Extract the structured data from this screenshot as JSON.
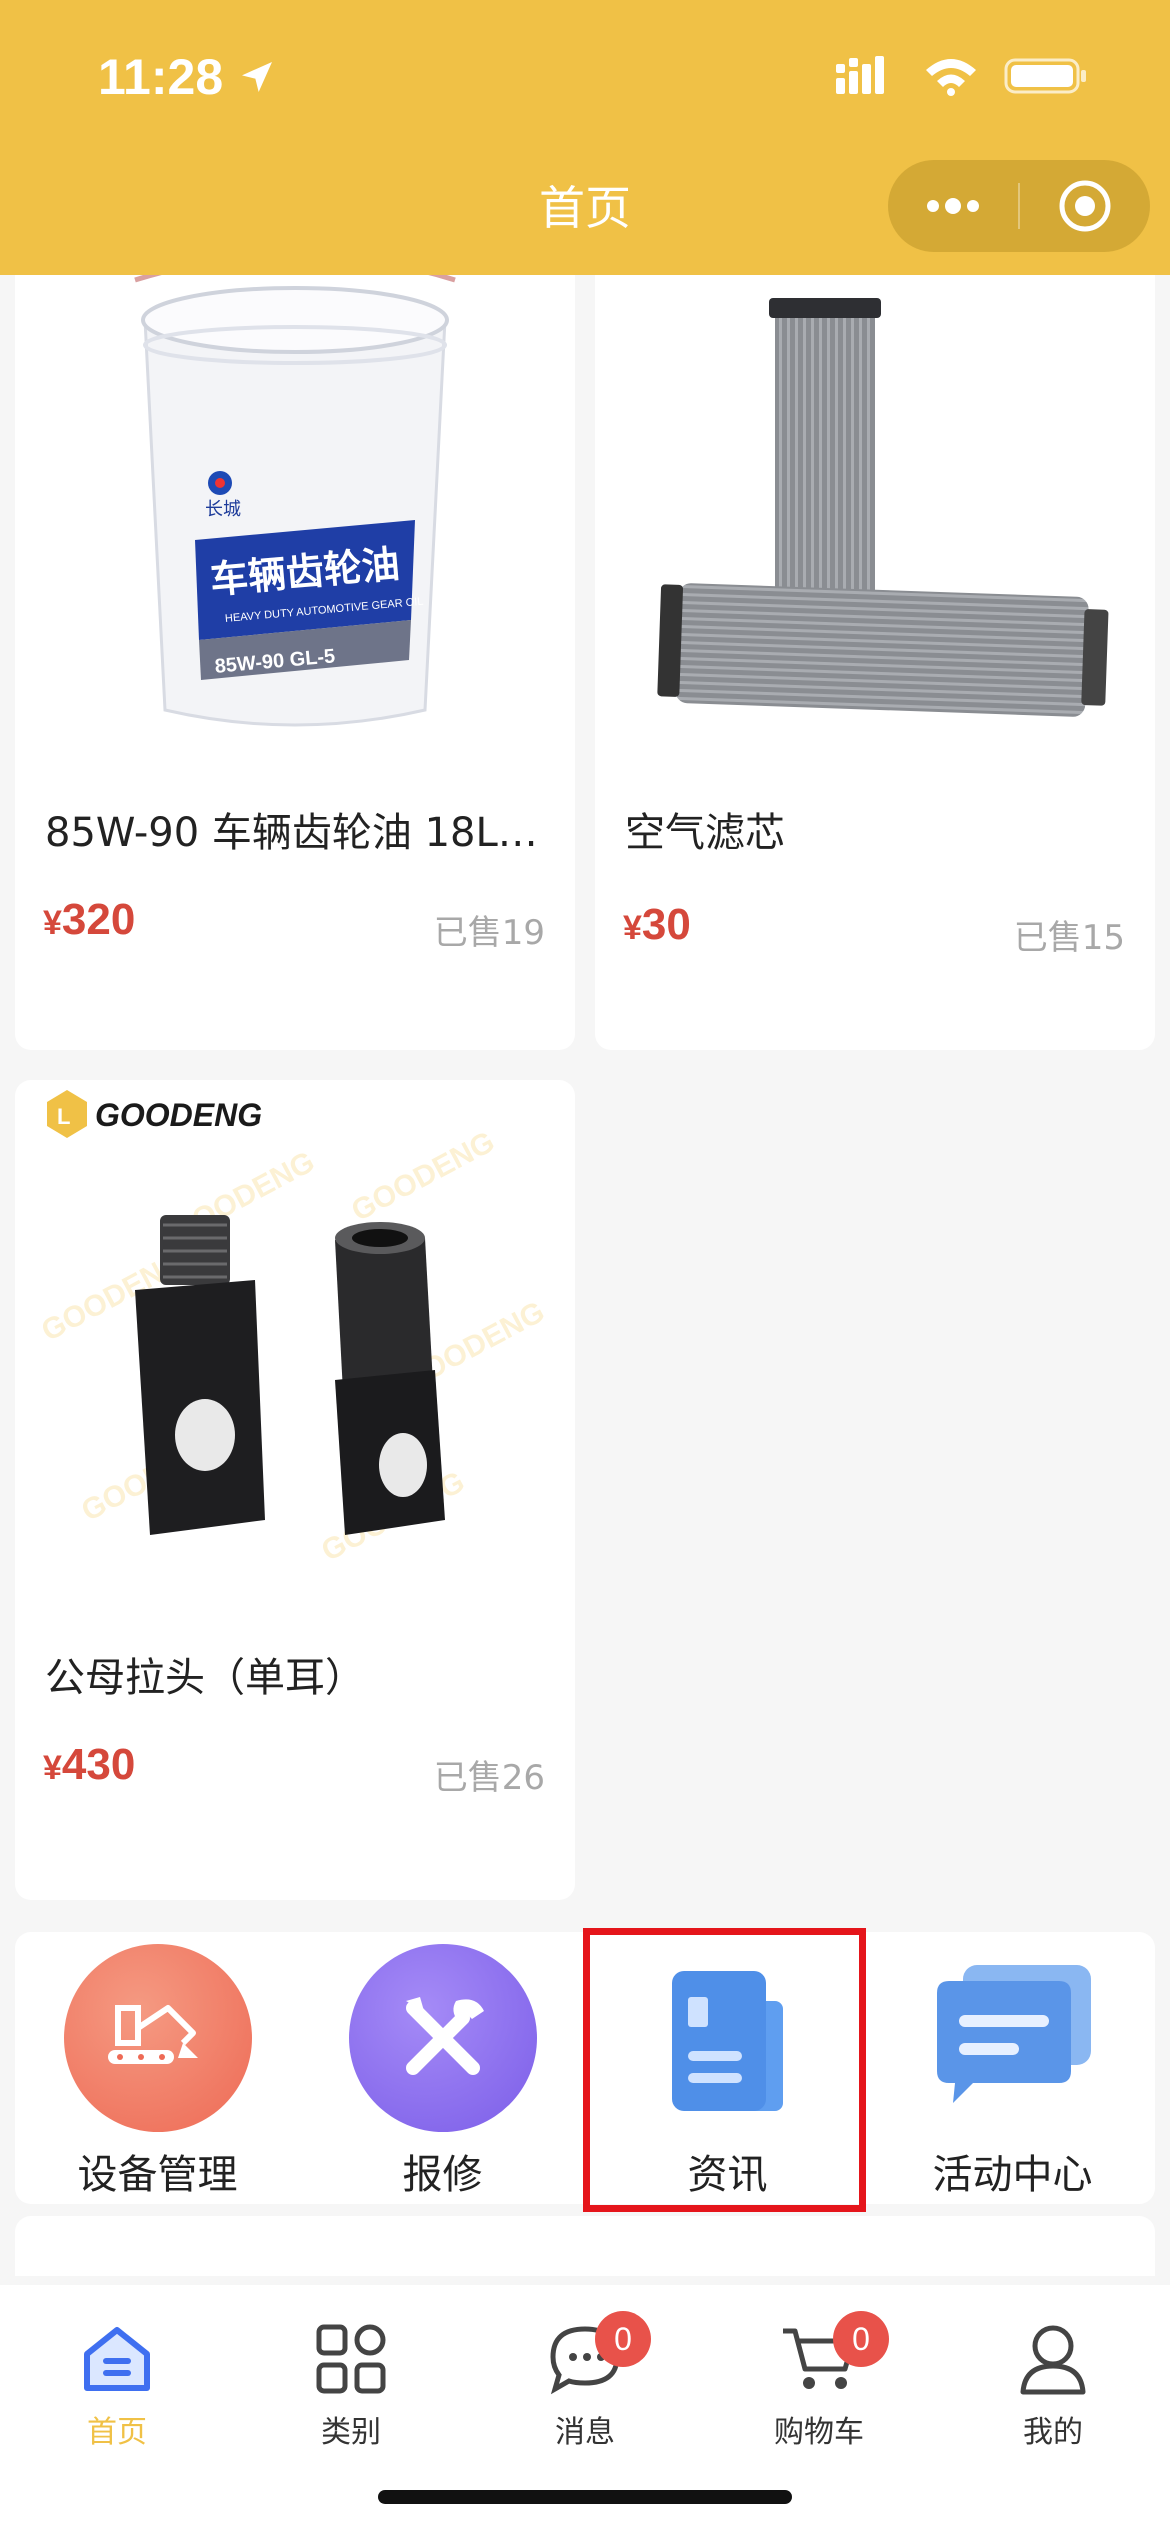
{
  "status_bar": {
    "time": "11:28"
  },
  "nav": {
    "title": "首页"
  },
  "products": [
    {
      "name": "85W-90 车辆齿轮油 18L…",
      "price_symbol": "¥",
      "price": "320",
      "sold": "已售19",
      "image_text": {
        "brand": "长城",
        "title": "车辆齿轮油",
        "subtitle": "HEAVY DUTY AUTOMOTIVE GEAR OIL",
        "grade": "85W-90 GL-5"
      }
    },
    {
      "name": "空气滤芯",
      "price_symbol": "¥",
      "price": "30",
      "sold": "已售15"
    },
    {
      "name": "公母拉头（单耳）",
      "price_symbol": "¥",
      "price": "430",
      "sold": "已售26",
      "image_text": {
        "logo": "GOODENG"
      }
    }
  ],
  "entries": [
    {
      "label": "设备管理",
      "icon": "excavator-icon",
      "color": "#ef6f55"
    },
    {
      "label": "报修",
      "icon": "wrench-screwdriver-icon",
      "color": "#8a67ee"
    },
    {
      "label": "资讯",
      "icon": "document-icon",
      "color": "#4e8fe8"
    },
    {
      "label": "活动中心",
      "icon": "chat-bubbles-icon",
      "color": "#5b93e6"
    }
  ],
  "tabbar": [
    {
      "label": "首页",
      "icon": "home-icon",
      "active": true
    },
    {
      "label": "类别",
      "icon": "grid-icon"
    },
    {
      "label": "消息",
      "icon": "message-icon",
      "badge": "0"
    },
    {
      "label": "购物车",
      "icon": "cart-icon",
      "badge": "0"
    },
    {
      "label": "我的",
      "icon": "user-icon"
    }
  ],
  "colors": {
    "header": "#f0c146",
    "price": "#d5483b",
    "badge": "#e8524a",
    "highlight": "#e5151b"
  }
}
